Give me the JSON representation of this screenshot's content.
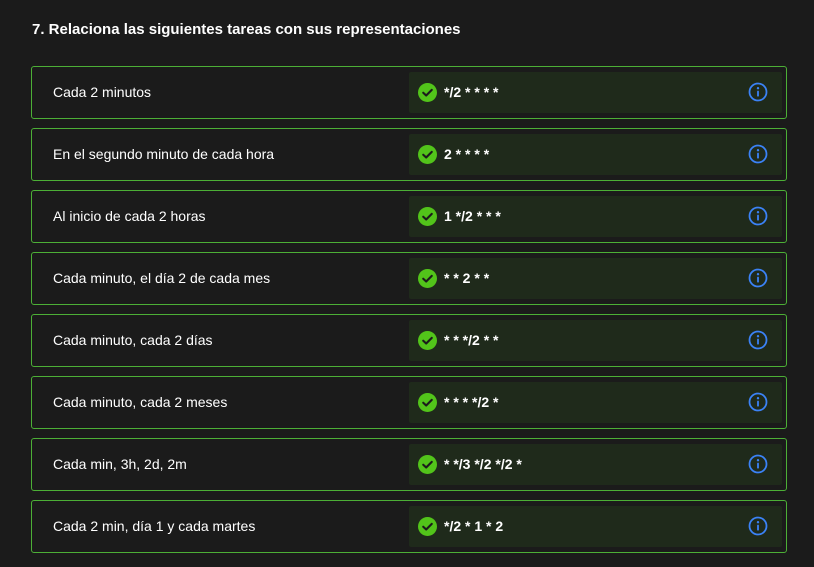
{
  "question": {
    "title": "7. Relaciona las siguientes tareas con sus representaciones"
  },
  "colors": {
    "background": "#1b1b1b",
    "row_border": "#4caf36",
    "answer_background": "#1f2a1b",
    "check": "#52c41a",
    "info": "#3b82f6"
  },
  "icons": {
    "status": "check-circle-icon",
    "info": "info-circle-icon"
  },
  "rows": [
    {
      "label": "Cada 2 minutos",
      "answer": "*/2 * * * *"
    },
    {
      "label": "En el segundo minuto de cada hora",
      "answer": "2 * * * *"
    },
    {
      "label": "Al inicio de cada 2 horas",
      "answer": "1 */2 * * *"
    },
    {
      "label": "Cada minuto, el día 2 de cada mes",
      "answer": "* * 2 * *"
    },
    {
      "label": "Cada minuto, cada 2 días",
      "answer": "* * */2 * *"
    },
    {
      "label": "Cada minuto, cada 2 meses",
      "answer": "* * * */2 *"
    },
    {
      "label": "Cada min, 3h, 2d, 2m",
      "answer": "* */3 */2 */2 *"
    },
    {
      "label": "Cada 2 min, día 1 y cada martes",
      "answer": "*/2 * 1 * 2"
    }
  ]
}
